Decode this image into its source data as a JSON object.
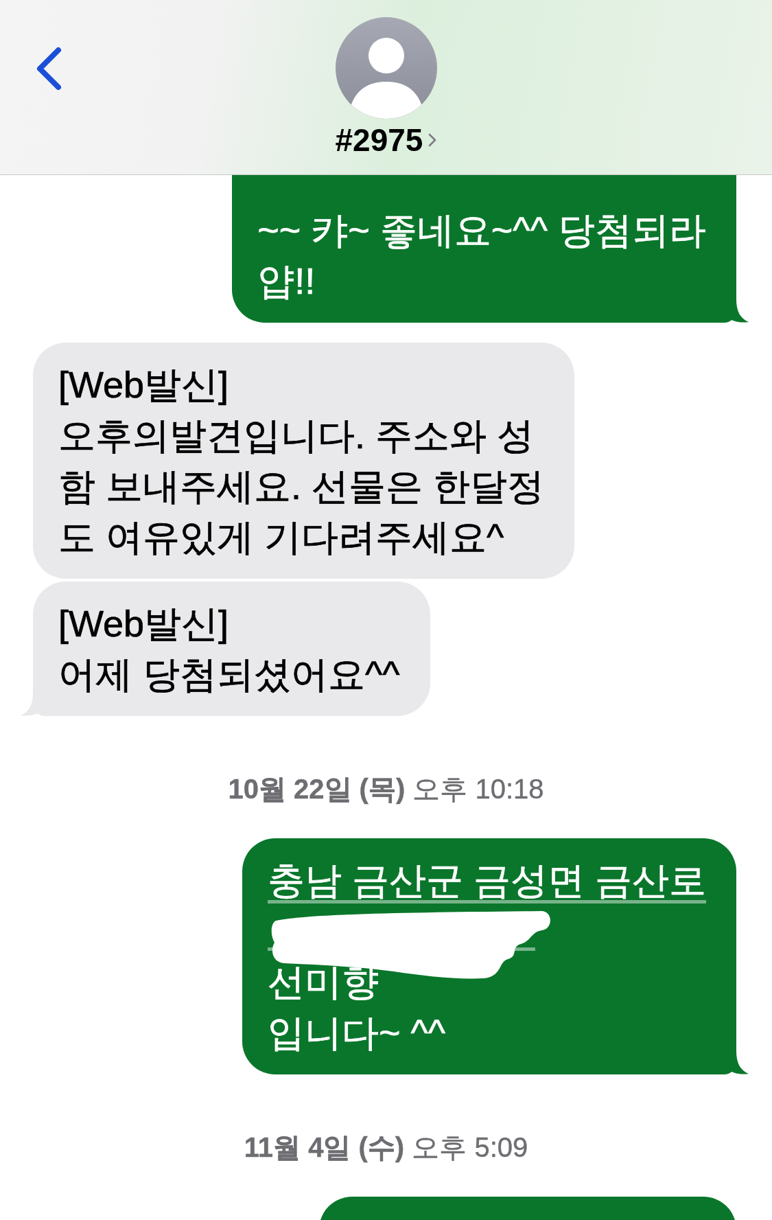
{
  "header": {
    "title": "#2975"
  },
  "items": [
    {
      "kind": "message",
      "outgoing": true,
      "tail": true,
      "parts": [
        {
          "kind": "text",
          "lines": [
            "~~ 캬~ 좋네요~^^ 당첨되라",
            "얍!!"
          ]
        }
      ]
    },
    {
      "kind": "message",
      "outgoing": false,
      "tail": false,
      "parts": [
        {
          "kind": "text",
          "lines": [
            "[Web발신]",
            "오후의발견입니다. 주소와 성",
            "함 보내주세요. 선물은 한달정",
            "도 여유있게 기다려주세요^"
          ]
        }
      ]
    },
    {
      "kind": "message",
      "outgoing": false,
      "tail": true,
      "parts": [
        {
          "kind": "text",
          "lines": [
            "[Web발신]",
            "어제 당첨되셨어요^^"
          ]
        }
      ]
    },
    {
      "kind": "timestamp",
      "text": "**10월 22일 (목)** 오후 10:18"
    },
    {
      "kind": "message",
      "outgoing": true,
      "tail": true,
      "parts": [
        {
          "kind": "link",
          "text": "충남 금산군 금성면 금산로"
        },
        {
          "kind": "redacted"
        },
        {
          "kind": "text",
          "lines": [
            "선미향",
            "입니다~ ^^"
          ]
        }
      ]
    },
    {
      "kind": "timestamp",
      "text": "**11월 4일 (수)** 오후 5:09"
    },
    {
      "kind": "message",
      "outgoing": true
    }
  ]
}
